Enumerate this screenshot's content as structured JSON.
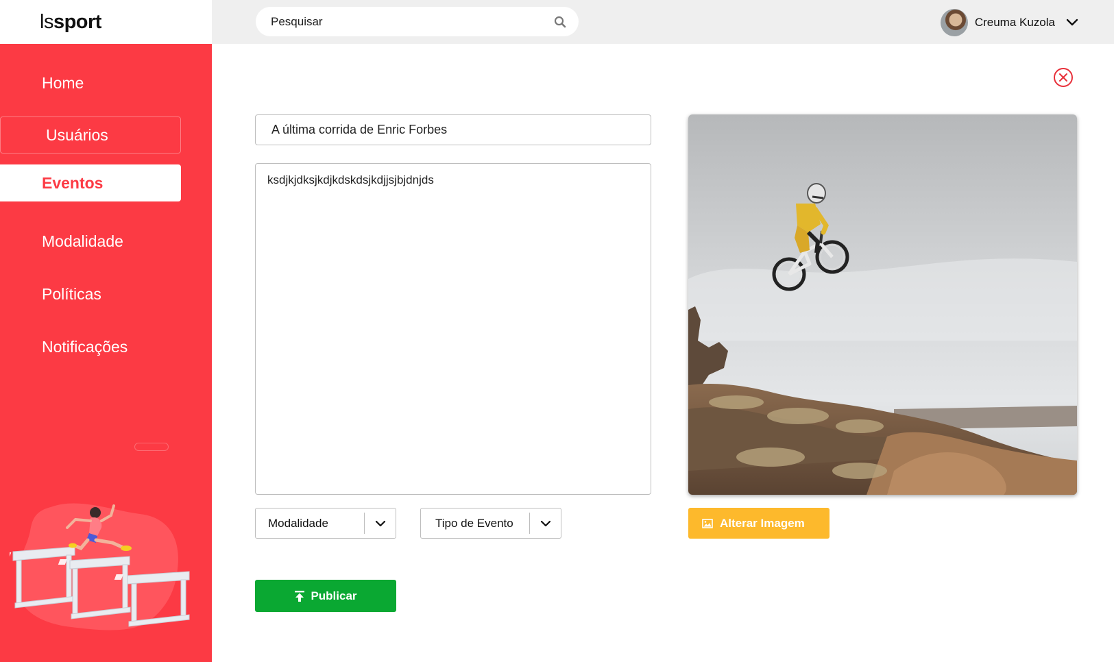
{
  "app": {
    "logo_light": "ls",
    "logo_bold": "sport"
  },
  "sidebar": {
    "items": [
      {
        "label": "Home"
      },
      {
        "label": "Usuários"
      },
      {
        "label": "Eventos"
      },
      {
        "label": "Modalidade"
      },
      {
        "label": "Políticas"
      },
      {
        "label": "Notificações"
      }
    ],
    "active_item": "Eventos",
    "illustration": "hurdle-runner-illustration"
  },
  "header": {
    "search": {
      "placeholder": "Pesquisar",
      "icon": "search-icon"
    },
    "user": {
      "name": "Creuma Kuzola",
      "menu_icon": "chevron-down-icon"
    }
  },
  "form": {
    "title_value": "A última corrida de Enric Forbes",
    "description_value": "ksdjkjdksjkdjkdskdsjkdjjsjbjdnjds",
    "modalidade_select": "Modalidade",
    "tipo_evento_select": "Tipo de Evento",
    "publish_label": "Publicar",
    "change_image_label": "Alterar Imagem",
    "image": "mountain-bike-jump-photo"
  },
  "colors": {
    "sidebar_red": "#fc3a44",
    "publish_green": "#0aa832",
    "change_image_yellow": "#fdb92c",
    "close_icon_red": "#e8303a"
  }
}
